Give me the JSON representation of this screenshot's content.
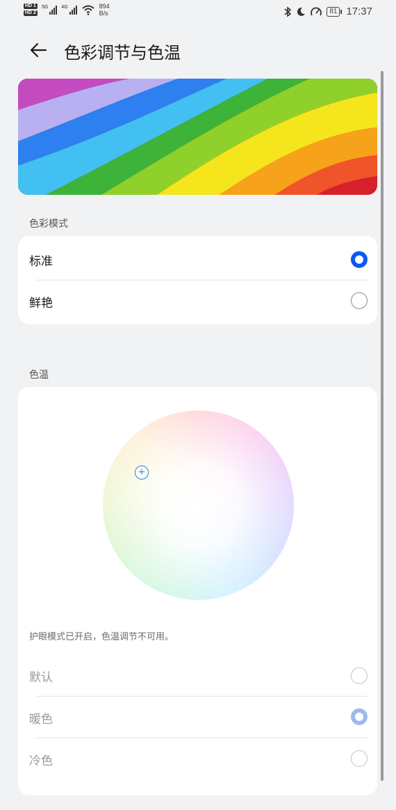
{
  "status_bar": {
    "hd1": "HD 1",
    "hd2": "HD 2",
    "sig1_tag": "5G",
    "sig2_tag": "4G",
    "net_speed_value": "894",
    "net_speed_unit": "B/s",
    "battery": "81",
    "time": "17:37"
  },
  "header": {
    "title": "色彩调节与色温"
  },
  "color_mode": {
    "section_label": "色彩模式",
    "options": [
      {
        "label": "标准",
        "selected": true
      },
      {
        "label": "鲜艳",
        "selected": false
      }
    ]
  },
  "color_temp": {
    "section_label": "色温",
    "note": "护眼模式已开启，色温调节不可用。",
    "options": [
      {
        "label": "默认",
        "selected": false
      },
      {
        "label": "暖色",
        "selected": true
      },
      {
        "label": "冷色",
        "selected": false
      }
    ],
    "enabled": false
  },
  "colors": {
    "accent": "#0a59f7",
    "accent_disabled": "#9fb9ee",
    "background": "#f1f2f4",
    "card": "#ffffff"
  }
}
